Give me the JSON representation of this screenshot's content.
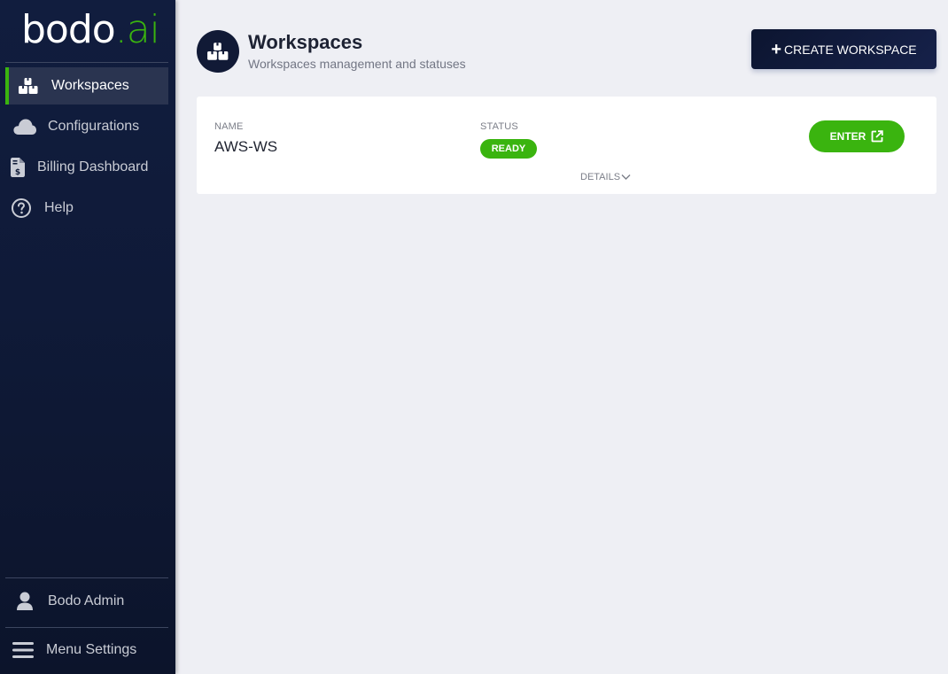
{
  "brand": {
    "logo_main": "bodo",
    "logo_accent": ".ai",
    "accent_color": "#3ab40f",
    "sidebar_color": "#111d3e"
  },
  "sidebar": {
    "items": [
      {
        "label": "Workspaces",
        "icon": "boxes-icon",
        "active": true
      },
      {
        "label": "Configurations",
        "icon": "cloud-icon",
        "active": false
      },
      {
        "label": "Billing Dashboard",
        "icon": "invoice-dollar-icon",
        "active": false
      },
      {
        "label": "Help",
        "icon": "question-circle-icon",
        "active": false
      }
    ],
    "footer": {
      "user_label": "Bodo Admin",
      "menu_settings_label": "Menu Settings"
    }
  },
  "header": {
    "title": "Workspaces",
    "subtitle": "Workspaces management and statuses",
    "create_button_label": "CREATE WORKSPACE"
  },
  "workspaces": [
    {
      "name_label": "NAME",
      "name": "AWS-WS",
      "status_label": "STATUS",
      "status": "READY",
      "status_color": "#3ab40f",
      "enter_label": "ENTER",
      "details_label": "DETAILS"
    }
  ]
}
